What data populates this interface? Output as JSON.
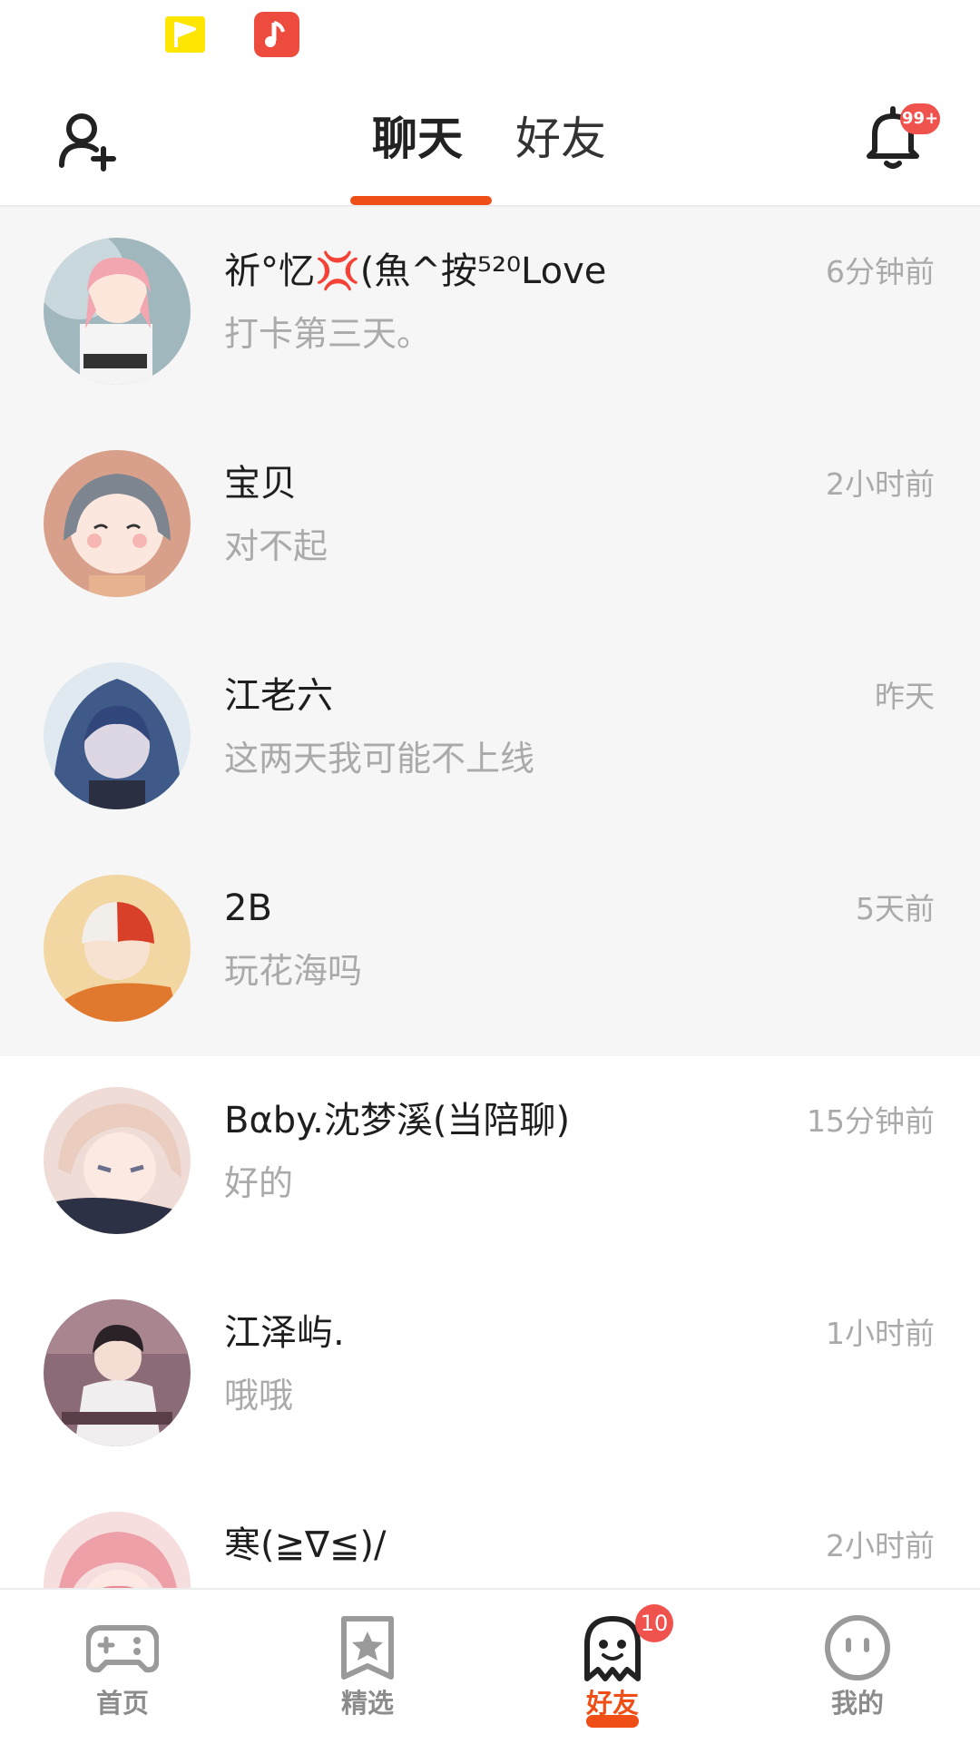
{
  "status_bar": {
    "icons": [
      "flag-notification-icon",
      "music-app-icon"
    ]
  },
  "header": {
    "tabs": [
      {
        "label": "聊天",
        "active": true
      },
      {
        "label": "好友",
        "active": false
      }
    ],
    "notification_badge": "99+",
    "accent_color": "#f04e17"
  },
  "chats": [
    {
      "name": "祈°忆💢(魚^按⁵²⁰Love",
      "message": "打卡第三天。",
      "time": "6分钟前",
      "pinned": true
    },
    {
      "name": "宝贝",
      "message": "对不起",
      "time": "2小时前",
      "pinned": true
    },
    {
      "name": "江老六",
      "message": "这两天我可能不上线",
      "time": "昨天",
      "pinned": true
    },
    {
      "name": "2B",
      "message": "玩花海吗",
      "time": "5天前",
      "pinned": true
    },
    {
      "name": "Bαby.沈梦溪(当陪聊)",
      "message": "好的",
      "time": "15分钟前",
      "pinned": false
    },
    {
      "name": "江泽屿.",
      "message": "哦哦",
      "time": "1小时前",
      "pinned": false
    },
    {
      "name": "寒(≧∇≦)/",
      "message": "",
      "time": "2小时前",
      "pinned": false
    }
  ],
  "bottom_nav": [
    {
      "label": "首页",
      "icon": "gamepad-icon",
      "active": false
    },
    {
      "label": "精选",
      "icon": "star-bookmark-icon",
      "active": false
    },
    {
      "label": "好友",
      "icon": "ghost-icon",
      "active": true,
      "badge": "10"
    },
    {
      "label": "我的",
      "icon": "face-icon",
      "active": false
    }
  ]
}
